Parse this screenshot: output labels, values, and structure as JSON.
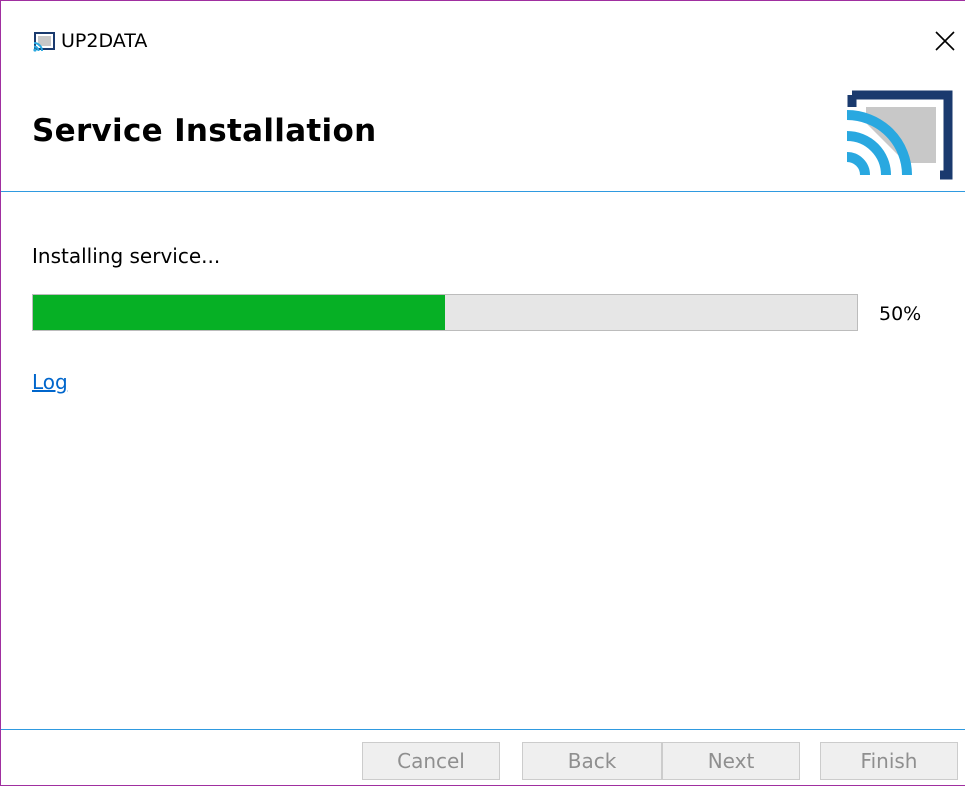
{
  "window": {
    "title": "UP2DATA",
    "app_icon": "wifi-cast-icon",
    "close_icon": "close-icon"
  },
  "header": {
    "title": "Service Installation",
    "logo": "up2data-logo-icon",
    "accent_color": "#2f9ae0"
  },
  "main": {
    "status_text": "Installing service...",
    "progress": {
      "percent_label": "50%",
      "value": 0.5,
      "fill_color": "#06b025"
    },
    "log_link": "Log"
  },
  "footer": {
    "cancel_label": "Cancel",
    "back_label": "Back",
    "next_label": "Next",
    "finish_label": "Finish"
  }
}
